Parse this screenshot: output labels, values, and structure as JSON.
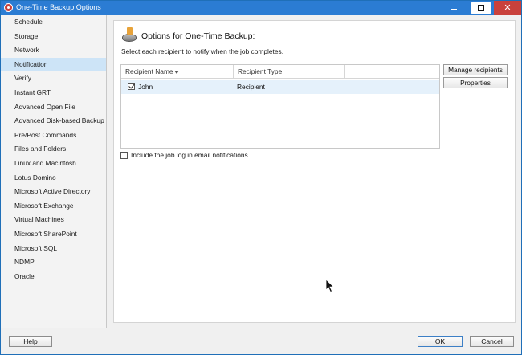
{
  "window": {
    "title": "One-Time Backup Options",
    "controls": {
      "minimize_icon": "minimize-icon",
      "maximize_icon": "maximize-icon",
      "close_icon": "close-icon",
      "close_glyph": "✕"
    },
    "accent_color": "#2b7cd3",
    "close_color": "#c9413c"
  },
  "sidebar": {
    "selected_color": "#cde4f7",
    "items": [
      {
        "label": "Schedule",
        "selected": false
      },
      {
        "label": "Storage",
        "selected": false
      },
      {
        "label": "Network",
        "selected": false
      },
      {
        "label": "Notification",
        "selected": true
      },
      {
        "label": "Verify",
        "selected": false
      },
      {
        "label": "Instant GRT",
        "selected": false
      },
      {
        "label": "Advanced Open File",
        "selected": false
      },
      {
        "label": "Advanced Disk-based Backup",
        "selected": false
      },
      {
        "label": "Pre/Post Commands",
        "selected": false
      },
      {
        "label": "Files and Folders",
        "selected": false
      },
      {
        "label": "Linux and Macintosh",
        "selected": false
      },
      {
        "label": "Lotus Domino",
        "selected": false
      },
      {
        "label": "Microsoft Active Directory",
        "selected": false
      },
      {
        "label": "Microsoft Exchange",
        "selected": false
      },
      {
        "label": "Virtual Machines",
        "selected": false
      },
      {
        "label": "Microsoft SharePoint",
        "selected": false
      },
      {
        "label": "Microsoft SQL",
        "selected": false
      },
      {
        "label": "NDMP",
        "selected": false
      },
      {
        "label": "Oracle",
        "selected": false
      }
    ]
  },
  "panel": {
    "icon": "backup-disk-icon",
    "title": "Options for One-Time Backup:",
    "description": "Select each recipient to notify when the job completes.",
    "grid": {
      "columns": [
        "Recipient Name",
        "Recipient Type",
        ""
      ],
      "sort_icon": "sort-down-icon",
      "rows": [
        {
          "checked": true,
          "name": "John",
          "type": "Recipient"
        }
      ]
    },
    "buttons": {
      "manage": "Manage recipients",
      "properties": "Properties"
    },
    "include_log": {
      "checked": false,
      "label": "Include the job log in email notifications"
    }
  },
  "footer": {
    "help": "Help",
    "ok": "OK",
    "cancel": "Cancel"
  }
}
